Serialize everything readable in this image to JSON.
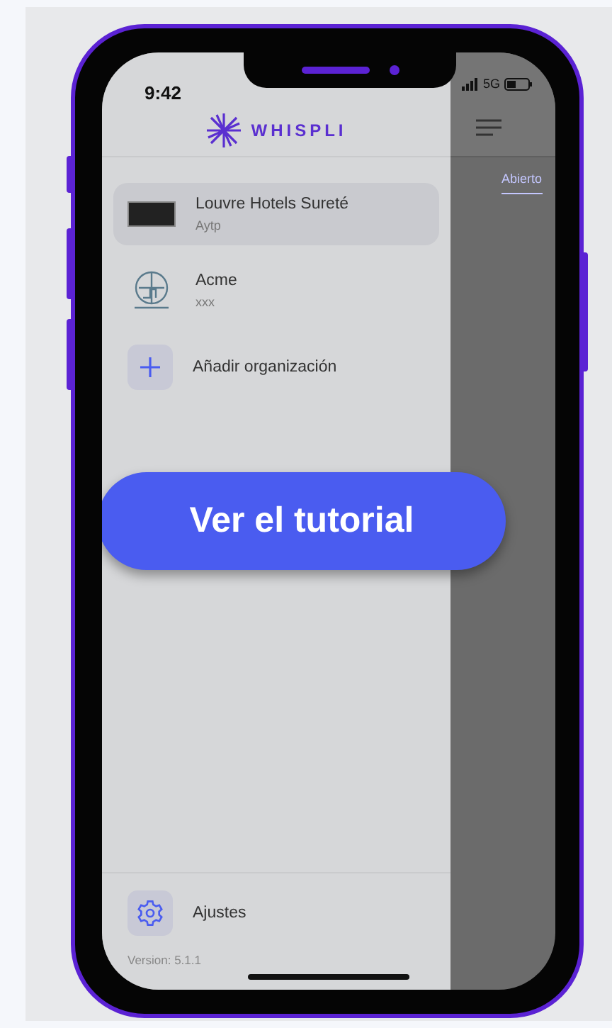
{
  "status_bar": {
    "time": "9:42",
    "network": "5G"
  },
  "drawer": {
    "brand": "WHISPLI",
    "organizations": [
      {
        "name": "Louvre Hotels Sureté",
        "subtitle": "Aytp",
        "kind": "dark-logo",
        "selected": true
      },
      {
        "name": "Acme",
        "subtitle": "xxx",
        "kind": "globe-logo",
        "selected": false
      }
    ],
    "add_organization": "Añadir organización",
    "settings": "Ajustes",
    "version": "Version: 5.1.1"
  },
  "background_tab": "Abierto",
  "tutorial_button": "Ver el tutorial"
}
